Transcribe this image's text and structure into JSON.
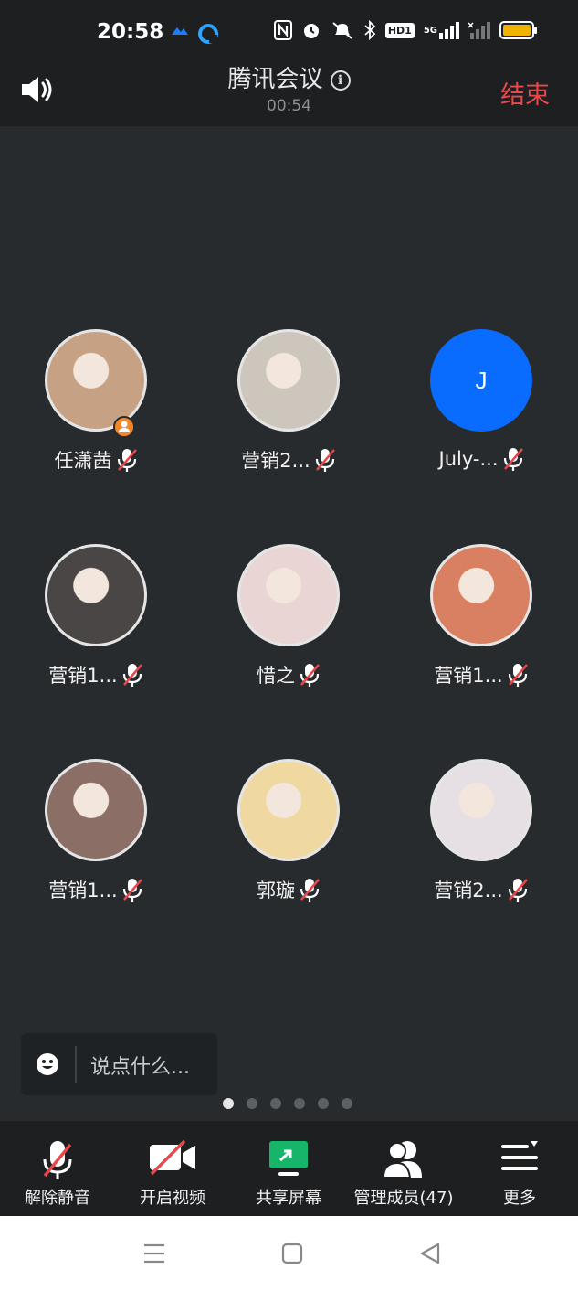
{
  "status_bar": {
    "time": "20:58",
    "network_label": "HD1",
    "signal_label": "5G"
  },
  "header": {
    "title": "腾讯会议",
    "timer": "00:54",
    "end_label": "结束"
  },
  "participants": [
    {
      "name": "任潇茜",
      "host": true,
      "avatar_color": "#c7a184"
    },
    {
      "name": "营销2...",
      "host": false,
      "avatar_color": "#cdc6bc"
    },
    {
      "name": "July-...",
      "host": false,
      "avatar_letter": "J",
      "avatar_color": "#0a6cff"
    },
    {
      "name": "营销1...",
      "host": false,
      "avatar_color": "#4a4646"
    },
    {
      "name": "惜之",
      "host": false,
      "avatar_color": "#e9d5d4"
    },
    {
      "name": "营销1...",
      "host": false,
      "avatar_color": "#d98062"
    },
    {
      "name": "营销1...",
      "host": false,
      "avatar_color": "#8b6e66"
    },
    {
      "name": "郭璇",
      "host": false,
      "avatar_color": "#f0d9a1"
    },
    {
      "name": "营销2...",
      "host": false,
      "avatar_color": "#e6dfe3"
    }
  ],
  "chat": {
    "placeholder": "说点什么..."
  },
  "pager": {
    "total": 6,
    "active": 1
  },
  "toolbar": {
    "unmute_label": "解除静音",
    "video_label": "开启视频",
    "share_label": "共享屏幕",
    "members_label": "管理成员(47)",
    "more_label": "更多"
  },
  "colors": {
    "background": "#272b2e",
    "bar": "#1d1f21",
    "end_red": "#e9484a",
    "share_green": "#17b56a",
    "avatar_blue": "#0a6cff",
    "host_orange": "#f5862a"
  }
}
